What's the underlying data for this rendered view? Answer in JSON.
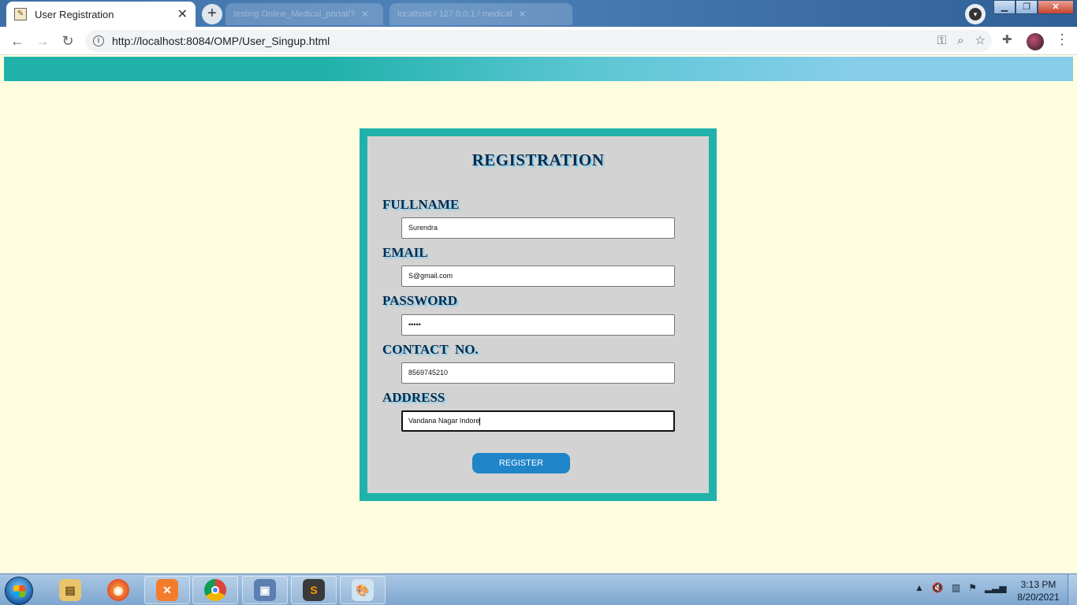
{
  "browser": {
    "active_tab_title": "User Registration",
    "background_tabs": [
      "testing Online_Medical_portal/?",
      "localhost / 127.0.0.1 / medical"
    ],
    "url": "http://localhost:8084/OMP/User_Singup.html",
    "nav_icons": [
      "back-icon",
      "forward-icon",
      "reload-icon"
    ]
  },
  "page": {
    "header_colors": [
      "#20b2aa",
      "#87ceeb"
    ],
    "background_color": "#fffde0"
  },
  "form": {
    "title": "REGISTRATION",
    "fields": [
      {
        "label": "FULLNAME",
        "value": "Surendra"
      },
      {
        "label": "EMAIL",
        "value": "S@gmail.com"
      },
      {
        "label": "PASSWORD",
        "value": "•••••"
      },
      {
        "label": "CONTACT  NO.",
        "value": "8569745210"
      },
      {
        "label": "ADDRESS",
        "value": "Vandana Nagar Indore"
      }
    ],
    "submit_label": "REGISTER",
    "frame_color": "#20b2aa",
    "button_color": "#1f85c8"
  },
  "taskbar": {
    "apps": [
      "file-explorer",
      "firefox",
      "xampp",
      "chrome",
      "virtualbox",
      "sublime-text",
      "paint"
    ],
    "clock_time": "3:13 PM",
    "clock_date": "8/20/2021"
  }
}
